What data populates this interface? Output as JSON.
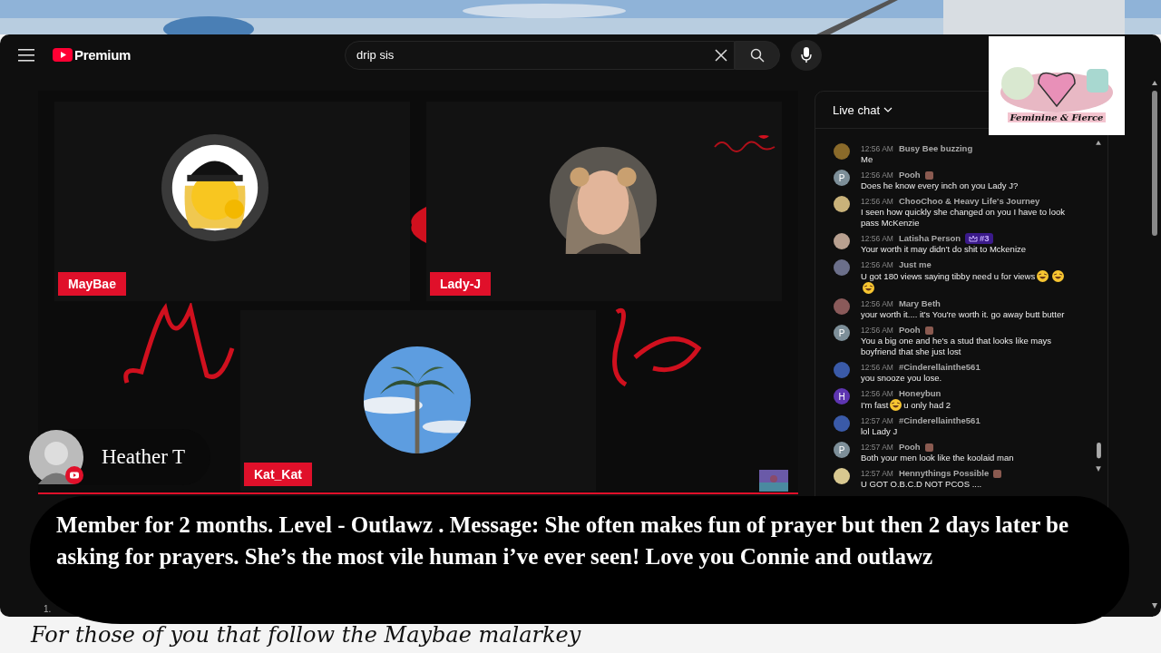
{
  "header": {
    "brand": "Premium",
    "search": {
      "value": "drip sis"
    }
  },
  "sticker": {
    "text": "Feminine & Fierce"
  },
  "stage": {
    "tiles": [
      {
        "name": "MayBae",
        "kind": "emoji"
      },
      {
        "name": "Lady-J",
        "kind": "person"
      },
      {
        "name": "Kat_Kat",
        "kind": "palm"
      }
    ]
  },
  "presenter": {
    "name": "Heather T"
  },
  "chat": {
    "title": "Live chat",
    "messages": [
      {
        "time": "12:56 AM",
        "author": "Busy Bee buzzing",
        "color": "#8a6a2a",
        "parts": [
          {
            "kind": "text",
            "text": "Me"
          }
        ]
      },
      {
        "time": "12:56 AM",
        "author": "Pooh",
        "avatar_letter": "P",
        "color": "#7d8f99",
        "author_emoji": true,
        "parts": [
          {
            "kind": "text",
            "text": "Does he know every inch on you Lady J?"
          }
        ]
      },
      {
        "time": "12:56 AM",
        "author": "ChooChoo & Heavy Life's Journey",
        "color": "#c9b27a",
        "parts": [
          {
            "kind": "text",
            "text": "I seen how quickly she changed on you I have to look pass McKenzie"
          }
        ]
      },
      {
        "time": "12:56 AM",
        "author": "Latisha Person",
        "color": "#b8a090",
        "badge": "#3",
        "parts": [
          {
            "kind": "text",
            "text": "Your worth it may didn't do shit to Mckenize"
          }
        ]
      },
      {
        "time": "12:56 AM",
        "author": "Just me",
        "color": "#6b6f8a",
        "parts": [
          {
            "kind": "text",
            "text": "U got 180 views saying tibby need u for views"
          },
          {
            "kind": "emoji"
          },
          {
            "kind": "emoji"
          },
          {
            "kind": "emoji"
          }
        ]
      },
      {
        "time": "12:56 AM",
        "author": "Mary Beth",
        "color": "#8a5a5a",
        "parts": [
          {
            "kind": "text",
            "text": "your worth it.... it's You're worth it. go away butt butter"
          }
        ]
      },
      {
        "time": "12:56 AM",
        "author": "Pooh",
        "avatar_letter": "P",
        "color": "#7d8f99",
        "author_emoji": true,
        "parts": [
          {
            "kind": "text",
            "text": "You a big one and he's a stud that looks like mays boyfriend that she just lost"
          }
        ]
      },
      {
        "time": "12:56 AM",
        "author": "#Cinderellainthe561",
        "color": "#3a5aa8",
        "parts": [
          {
            "kind": "text",
            "text": "you snooze you lose."
          }
        ]
      },
      {
        "time": "12:56 AM",
        "author": "Honeybun",
        "avatar_letter": "H",
        "color": "#5e35b1",
        "parts": [
          {
            "kind": "text",
            "text": "I'm fast"
          },
          {
            "kind": "emoji"
          },
          {
            "kind": "text",
            "text": "u only had 2"
          }
        ]
      },
      {
        "time": "12:57 AM",
        "author": "#Cinderellainthe561",
        "color": "#3a5aa8",
        "parts": [
          {
            "kind": "text",
            "text": "lol Lady J"
          }
        ]
      },
      {
        "time": "12:57 AM",
        "author": "Pooh",
        "avatar_letter": "P",
        "color": "#7d8f99",
        "author_emoji": true,
        "parts": [
          {
            "kind": "text",
            "text": "Both your men look like the koolaid man"
          }
        ]
      },
      {
        "time": "12:57 AM",
        "author": "Hennythings Possible",
        "color": "#d8c890",
        "author_emoji": true,
        "parts": [
          {
            "kind": "text",
            "text": "U GOT O.B.C.D NOT PCOS ...."
          }
        ]
      }
    ]
  },
  "caption": "Member for 2 months. Level - Outlawz . Message: She often makes fun of prayer but then 2 days later be asking for prayers. She’s the most vile human i’ve ever seen! Love you Connie and outlawz",
  "footnote": "1.",
  "footer_text": "For those of you that follow the Maybae malarkey"
}
